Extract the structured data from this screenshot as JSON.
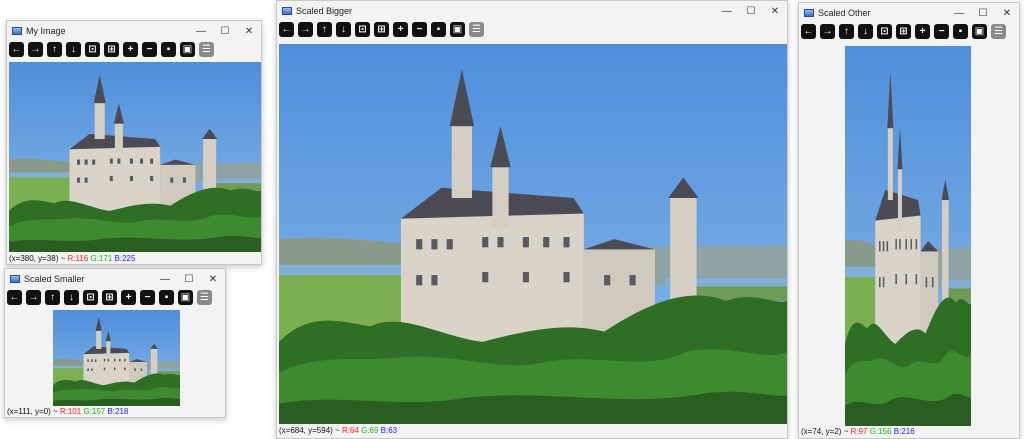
{
  "windows": {
    "my_image": {
      "title": "My Image",
      "status": {
        "coords": "(x=380, y=38) ~ ",
        "r": "R:116",
        "g": "G:171",
        "b": "B:225"
      }
    },
    "scaled_smaller": {
      "title": "Scaled Smaller",
      "status": {
        "coords": "(x=111, y=0) ~ ",
        "r": "R:101",
        "g": "G:157",
        "b": "B:218"
      }
    },
    "scaled_bigger": {
      "title": "Scaled Bigger",
      "status": {
        "coords": "(x=684, y=594) ~ ",
        "r": "R:64",
        "g": "G:69",
        "b": "B:63"
      }
    },
    "scaled_other": {
      "title": "Scaled Other",
      "status": {
        "coords": "(x=74, y=2) ~ ",
        "r": "R:97",
        "g": "G:156",
        "b": "B:216"
      }
    }
  },
  "window_controls": {
    "minimize": "—",
    "maximize": "☐",
    "close": "✕"
  },
  "toolbar": {
    "pan_left": "←",
    "pan_right": "→",
    "pan_up": "↑",
    "pan_down": "↓",
    "zoom_in": "+",
    "zoom_out": "−",
    "save": "▪",
    "copy": "▣",
    "properties": "☰"
  },
  "colors": {
    "sky": "#6aa0dc",
    "castle": "#d8d2c8",
    "roof": "#4a4a52",
    "forest": "#2f6e25",
    "red": "#ff2020",
    "green": "#17b817",
    "blue": "#2020ff"
  }
}
